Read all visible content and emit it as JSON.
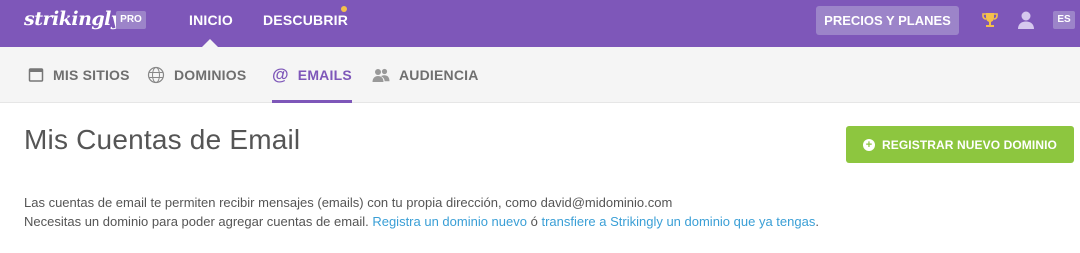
{
  "topbar": {
    "logo": "strikingly",
    "pro_badge": "PRO",
    "nav": {
      "inicio": "INICIO",
      "descubrir": "DESCUBRIR"
    },
    "pricing_button": "PRECIOS Y PLANES",
    "language": "ES"
  },
  "subnav": {
    "tabs": [
      {
        "label": "MIS SITIOS",
        "icon": "window-icon",
        "active": false
      },
      {
        "label": "DOMINIOS",
        "icon": "www-globe-icon",
        "active": false
      },
      {
        "label": "EMAILS",
        "icon": "at-icon",
        "active": true
      },
      {
        "label": "AUDIENCIA",
        "icon": "users-icon",
        "active": false
      }
    ]
  },
  "main": {
    "title": "Mis Cuentas de Email",
    "register_button": "REGISTRAR NUEVO DOMINIO",
    "description_line1": "Las cuentas de email te permiten recibir mensajes (emails) con tu propia dirección, como david@midominio.com",
    "description_line2_prefix": "Necesitas un dominio para poder agregar cuentas de email. ",
    "link_register": "Registra un dominio nuevo",
    "connector": " ó ",
    "link_transfer": "transfiere a Strikingly un dominio que ya tengas",
    "suffix": "."
  },
  "colors": {
    "brand_purple": "#7e57b9",
    "badge_purple": "#9c84c9",
    "green": "#8dc63f",
    "link_blue": "#3a9fd6"
  }
}
